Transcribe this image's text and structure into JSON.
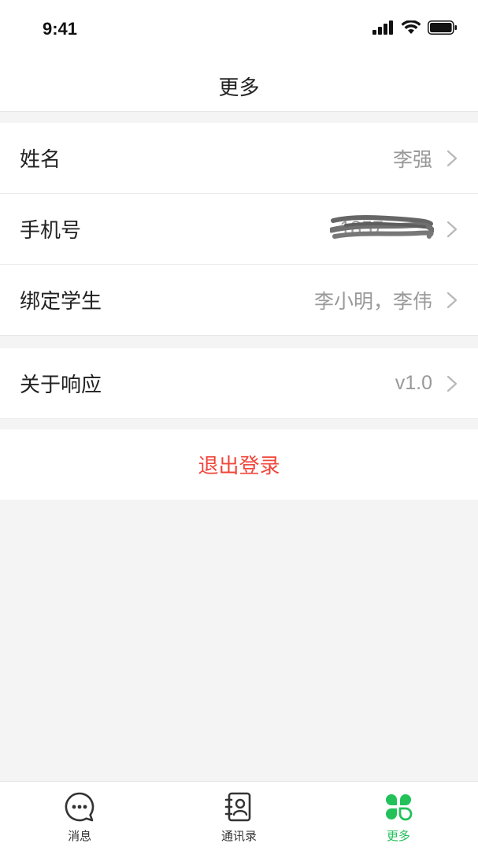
{
  "status_bar": {
    "time": "9:41"
  },
  "header": {
    "title": "更多"
  },
  "profile_rows": [
    {
      "label": "姓名",
      "value": "李强"
    },
    {
      "label": "手机号",
      "value": "1857"
    },
    {
      "label": "绑定学生",
      "value": "李小明，李伟"
    }
  ],
  "about_rows": [
    {
      "label": "关于响应",
      "value": "v1.0"
    }
  ],
  "logout": {
    "label": "退出登录"
  },
  "tabs": [
    {
      "label": "消息",
      "icon": "chat-bubble-icon"
    },
    {
      "label": "通讯录",
      "icon": "contacts-book-icon"
    },
    {
      "label": "更多",
      "icon": "clover-icon",
      "active": true
    }
  ],
  "colors": {
    "accent": "#22c15a",
    "danger": "#f0463c",
    "background": "#f4f4f4"
  }
}
